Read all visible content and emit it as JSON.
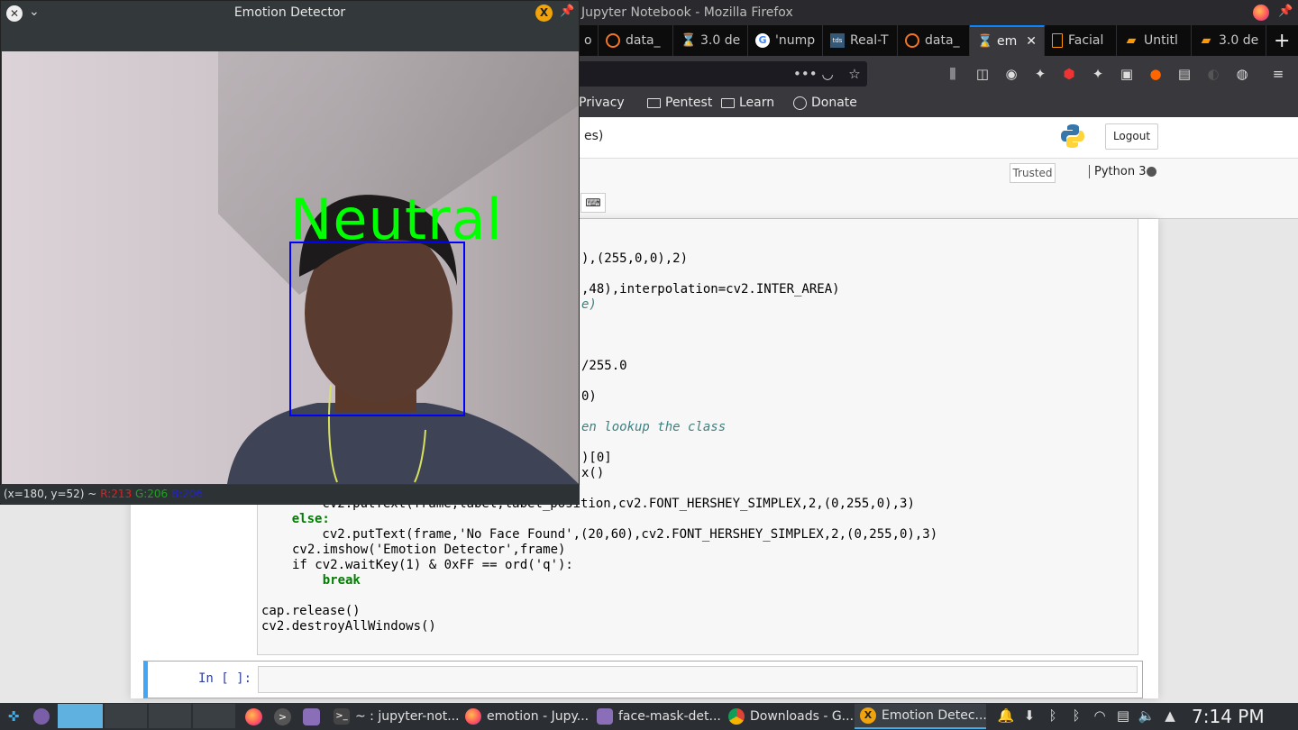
{
  "firefox": {
    "window_title": "Jupyter Notebook - Mozilla Firefox",
    "tabs": [
      {
        "label": "o",
        "active": false
      },
      {
        "label": "data_",
        "active": false
      },
      {
        "label": "3.0 de",
        "active": false
      },
      {
        "label": "'nump",
        "active": false
      },
      {
        "label": "Real-T",
        "active": false
      },
      {
        "label": "data_",
        "active": false
      },
      {
        "label": "em",
        "active": true
      },
      {
        "label": "Facial",
        "active": false
      },
      {
        "label": "Untitl",
        "active": false
      },
      {
        "label": "3.0 de",
        "active": false
      }
    ],
    "url_more": "•••",
    "bookmarks": [
      "Privacy",
      "Pentest",
      "Learn",
      "Donate"
    ]
  },
  "jupyter": {
    "notebook_name": "es)",
    "logout": "Logout",
    "trusted": "Trusted",
    "kernel": "Python 3",
    "keyboard_icon": "⌨",
    "code_lines": [
      "),(255,0,0),2)",
      ",48),interpolation=cv2.INTER_AREA)",
      "e)",
      "/255.0",
      "0)",
      "en lookup the class",
      ")[0]",
      "x()",
      "        cv2.putText(frame,label,label_position,cv2.FONT_HERSHEY_SIMPLEX,2,(0,255,0),3)",
      "    else:",
      "        cv2.putText(frame,'No Face Found',(20,60),cv2.FONT_HERSHEY_SIMPLEX,2,(0,255,0),3)",
      "cv2.imshow('Emotion Detector',frame)",
      "if cv2.waitKey(1) & 0xFF == ord('q'):",
      "    break",
      "cap.release()",
      "cv2.destroyAllWindows()"
    ],
    "prompt": "In [ ]:"
  },
  "cv_window": {
    "title": "Emotion Detector",
    "emotion_label": "Neutral",
    "status_coords": "(x=180, y=52) ~",
    "status_r": "R:213",
    "status_g": "G:206",
    "status_b": "B:206"
  },
  "taskbar": {
    "items": [
      "~ : jupyter-not...",
      "emotion - Jupy...",
      "face-mask-det...",
      "Downloads - G...",
      "Emotion Detec..."
    ],
    "clock": "7:14 PM"
  },
  "colors": {
    "accent": "#0a84ff",
    "label_green": "#00ff00",
    "face_box": "#0000ff"
  }
}
